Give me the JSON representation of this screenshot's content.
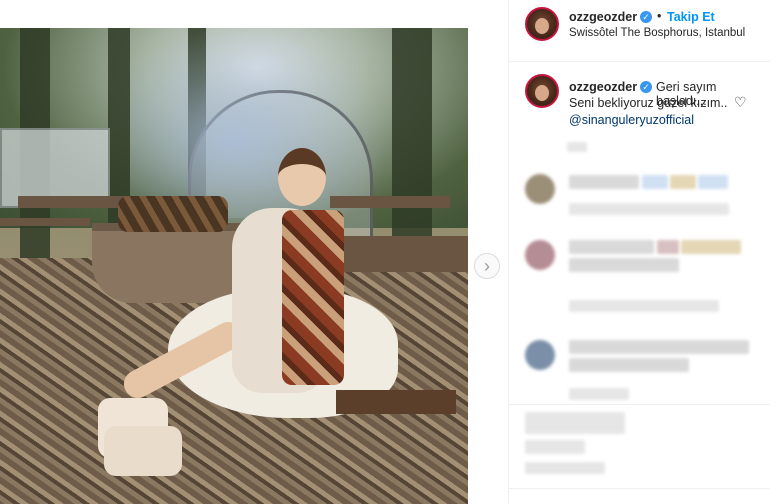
{
  "post": {
    "author": "ozzgeozder",
    "follow_label": "Takip Et",
    "separator": "•",
    "location": "Swissôtel The Bosphorus, Istanbul"
  },
  "caption": {
    "author": "ozzgeozder",
    "line1": "Geri sayım başladı...",
    "line2": "Seni bekliyoruz güzel kızım..",
    "mention": "@sinanguleryuzofficial"
  },
  "navigation": {
    "next_arrow": "›"
  },
  "icons": {
    "verified": "✓",
    "heart": "♡"
  },
  "colors": {
    "accent_link": "#0095f6",
    "mention": "#00376b",
    "verified_badge": "#3897f0",
    "avatar_ring": "#c8153f"
  }
}
